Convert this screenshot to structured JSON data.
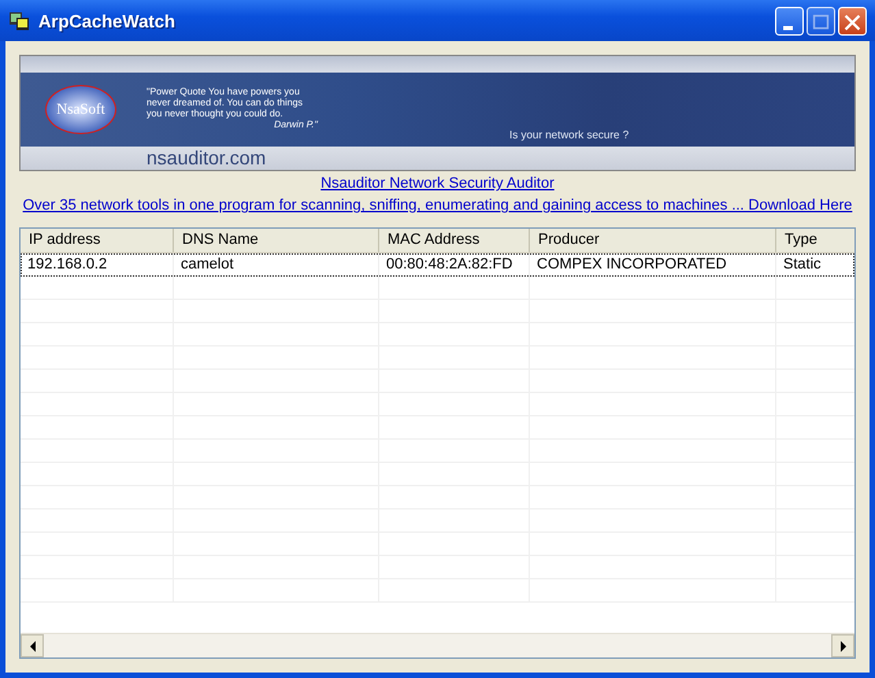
{
  "window": {
    "title": "ArpCacheWatch"
  },
  "banner": {
    "logo": "NsaSoft",
    "quote": "\"Power Quote You have powers you never dreamed of. You can do things you never thought you could do.",
    "quote_author": "Darwin P.\"",
    "site": "nsauditor.com",
    "tagline": "Is your network secure ?"
  },
  "links": [
    "Nsauditor Network Security Auditor",
    "Over 35 network tools in one program for scanning, sniffing, enumerating and gaining access to machines ...  Download Here"
  ],
  "table": {
    "columns": [
      "IP address",
      "DNS Name",
      "MAC Address",
      "Producer",
      "Type"
    ],
    "rows": [
      {
        "cells": [
          "192.168.0.2",
          "camelot",
          "00:80:48:2A:82:FD",
          "COMPEX INCORPORATED",
          "Static"
        ],
        "selected": false
      }
    ]
  }
}
